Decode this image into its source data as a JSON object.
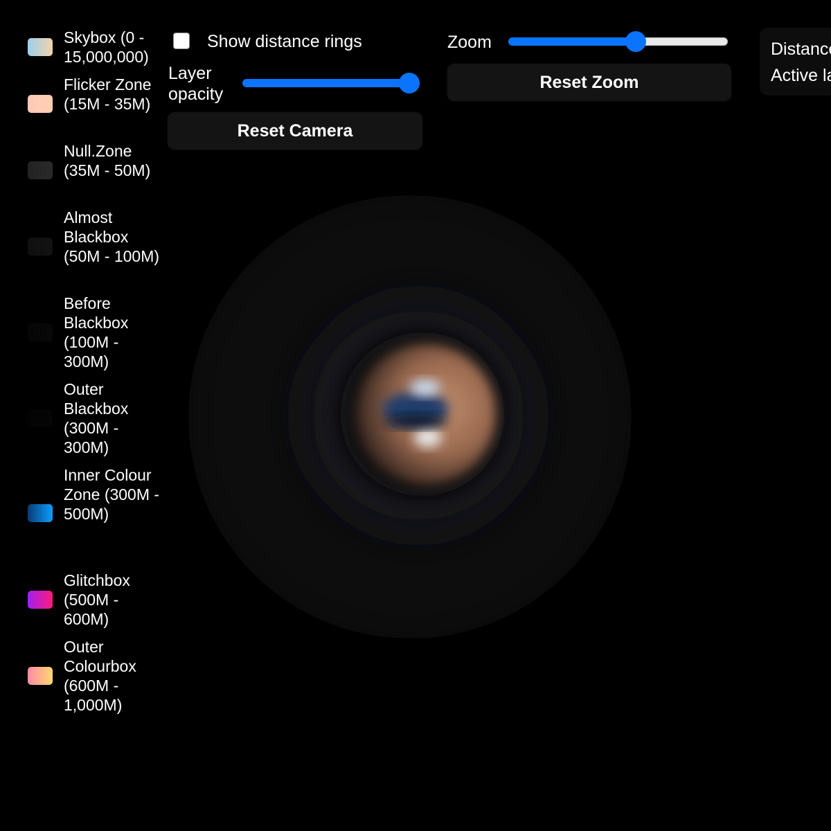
{
  "legend": {
    "items": [
      {
        "label": "Skybox (0 - 15,000,000)",
        "color_start": "#9cd0f0",
        "color_end": "#f3d2a8"
      },
      {
        "label": "Flicker Zone (15M - 35M)",
        "color_start": "#ffc8b8",
        "color_end": "#ffd0b0"
      },
      {
        "label": "Null.Zone (35M - 50M)",
        "color_start": "#222222",
        "color_end": "#2a2a2a"
      },
      {
        "label": "Almost Blackbox (50M - 100M)",
        "color_start": "#101010",
        "color_end": "#121212"
      },
      {
        "label": "Before Blackbox (100M - 300M)",
        "color_start": "#060606",
        "color_end": "#080808"
      },
      {
        "label": "Outer Blackbox (300M - 300M)",
        "color_start": "#030303",
        "color_end": "#050505"
      },
      {
        "label": "Inner Colour Zone (300M - 500M)",
        "color_start": "#0a3a78",
        "color_end": "#0aa0ff"
      },
      {
        "label": "Glitchbox (500M - 600M)",
        "color_start": "#a020f0",
        "color_end": "#ff1a7a"
      },
      {
        "label": "Outer Colourbox (600M - 1,000M)",
        "color_start": "#ff8aa8",
        "color_end": "#ffd870"
      }
    ]
  },
  "controls": {
    "show_rings_label": "Show distance rings",
    "show_rings_checked": false,
    "layer_opacity_label": "Layer opacity",
    "layer_opacity_value": 1.0,
    "reset_camera_label": "Reset Camera",
    "zoom_label": "Zoom",
    "zoom_value": 0.59,
    "reset_zoom_label": "Reset Zoom"
  },
  "info": {
    "distance_text": "Distance",
    "active_layer_text": "Active layer"
  },
  "colors": {
    "accent": "#0a74ff",
    "background": "#000000",
    "button_bg": "#141414",
    "planet": "#b8866a"
  }
}
